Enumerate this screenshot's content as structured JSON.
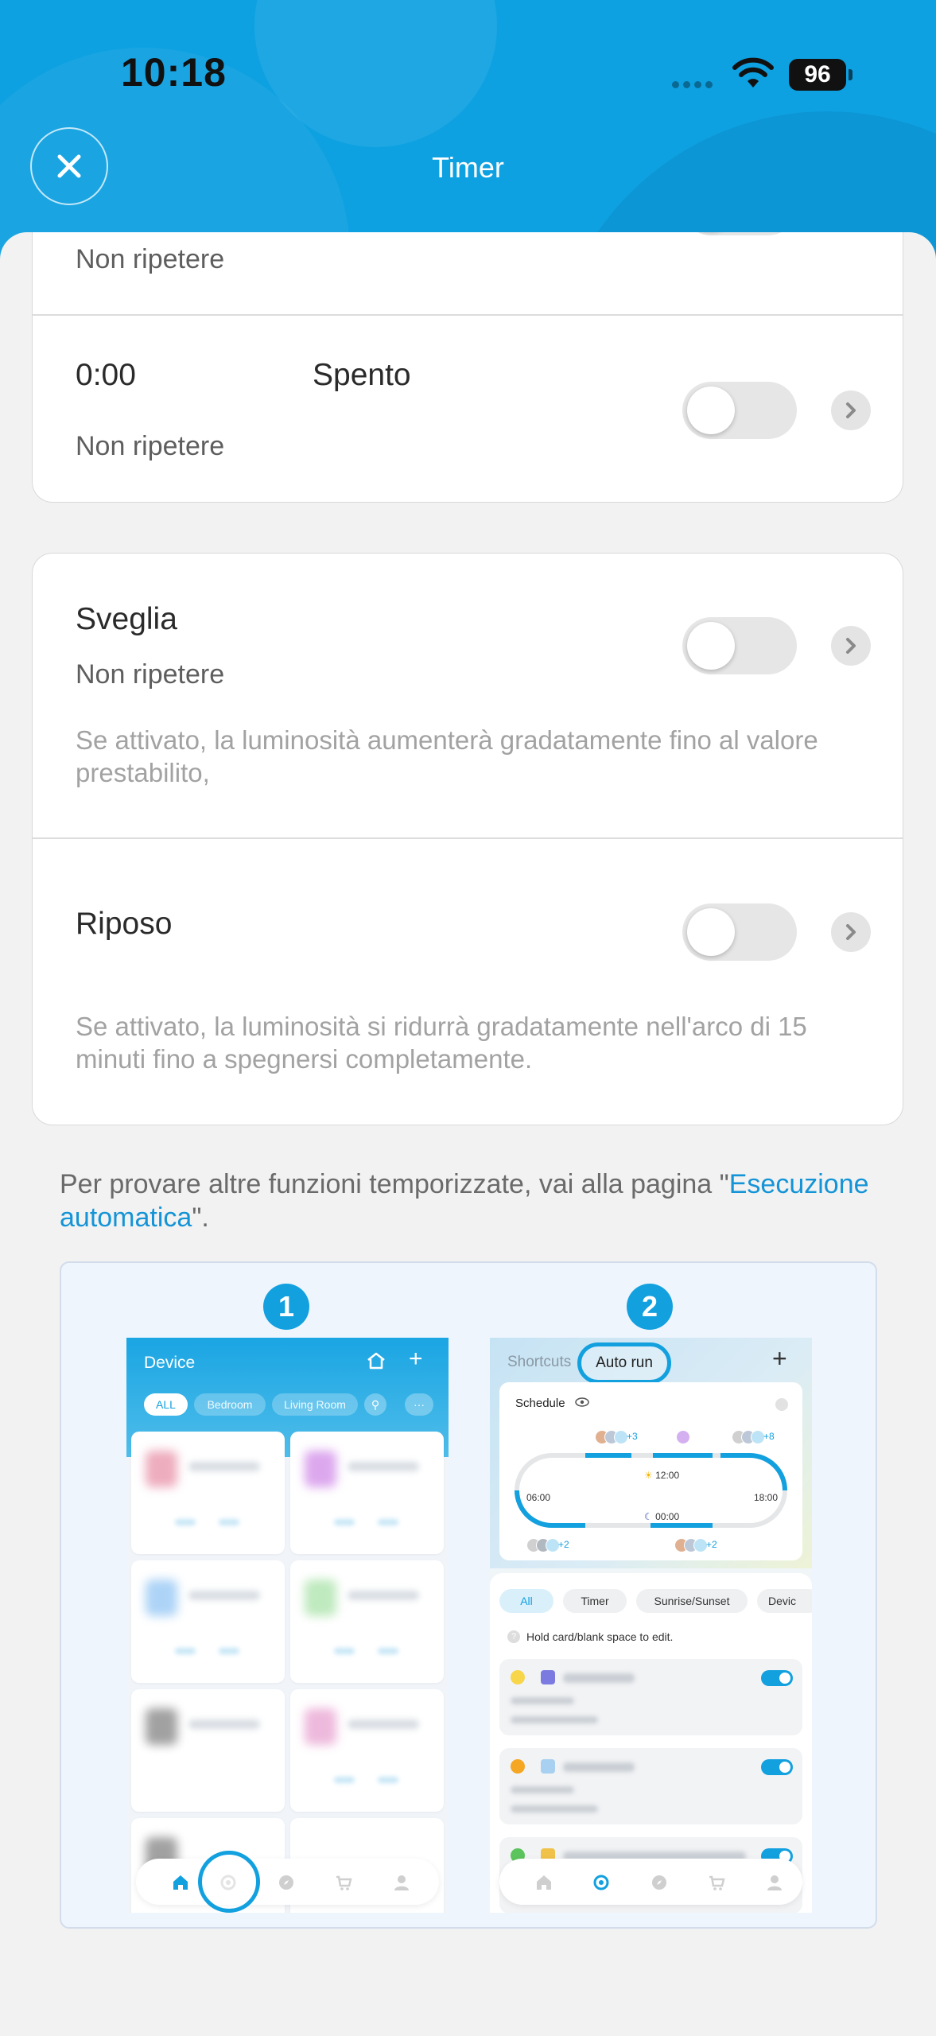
{
  "status_bar": {
    "time": "10:18",
    "battery": "96"
  },
  "header": {
    "title": "Timer"
  },
  "timers": [
    {
      "time": "",
      "mode": "",
      "repeat": "Non ripetere",
      "enabled": false
    },
    {
      "time": "0:00",
      "mode": "Spento",
      "repeat": "Non ripetere",
      "enabled": false
    }
  ],
  "wake": {
    "title": "Sveglia",
    "repeat": "Non ripetere",
    "description": "Se attivato, la luminosità aumenterà gradatamente fino al valore prestabilito,",
    "enabled": false
  },
  "sleep": {
    "title": "Riposo",
    "description": "Se attivato, la luminosità si ridurrà gradatamente nell'arco di 15 minuti fino a spegnersi completamente.",
    "enabled": false
  },
  "hint": {
    "before": "Per provare altre funzioni temporizzate, vai alla pagina \"",
    "link": "Esecuzione automatica",
    "after": "\"."
  },
  "illustration": {
    "step1": "1",
    "step2": "2",
    "left_phone": {
      "title": "Device",
      "chips": [
        "ALL",
        "Bedroom",
        "Living Room"
      ]
    },
    "right_phone": {
      "tabs": [
        "Shortcuts",
        "Auto run"
      ],
      "schedule_title": "Schedule",
      "times": [
        "12:00",
        "06:00",
        "18:00",
        "00:00"
      ],
      "avatar_counts": [
        "+3",
        "+8",
        "+2",
        "+2"
      ],
      "filters": [
        "All",
        "Timer",
        "Sunrise/Sunset",
        "Devic"
      ],
      "hold_tip": "Hold card/blank space to edit."
    }
  }
}
